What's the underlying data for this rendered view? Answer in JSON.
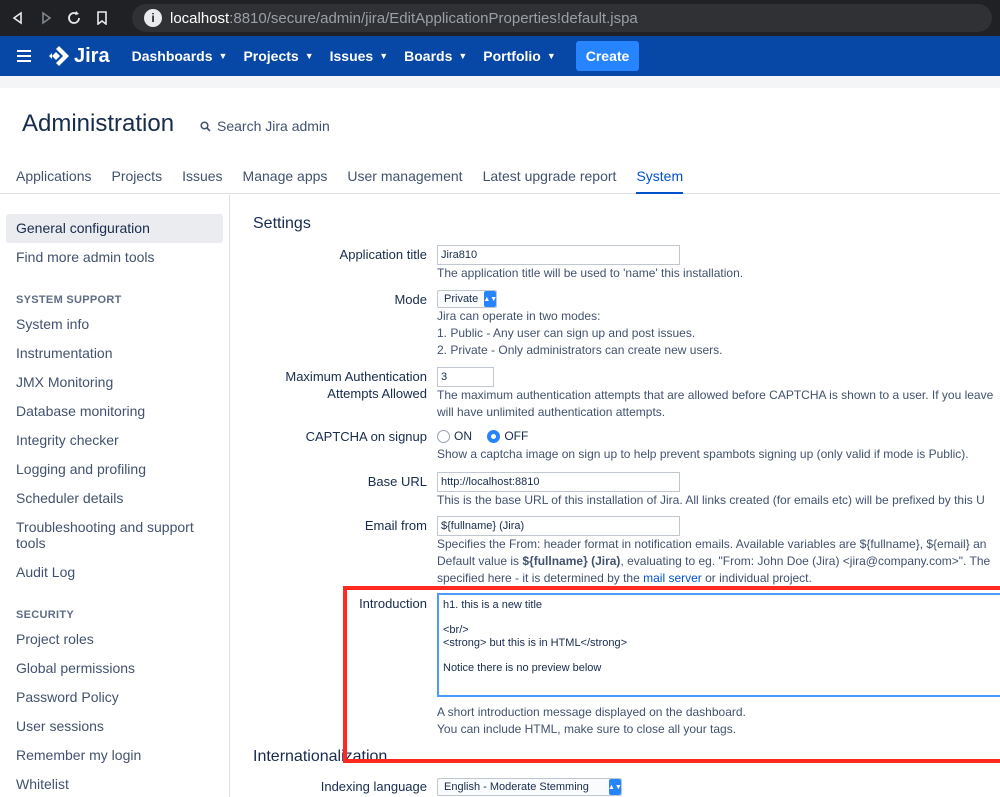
{
  "browser": {
    "url_host": "localhost",
    "url_rest": ":8810/secure/admin/jira/EditApplicationProperties!default.jspa"
  },
  "nav": {
    "logo": "Jira",
    "items": [
      {
        "label": "Dashboards"
      },
      {
        "label": "Projects"
      },
      {
        "label": "Issues"
      },
      {
        "label": "Boards"
      },
      {
        "label": "Portfolio"
      }
    ],
    "create": "Create"
  },
  "admin": {
    "title": "Administration",
    "search": "Search Jira admin",
    "tabs": [
      "Applications",
      "Projects",
      "Issues",
      "Manage apps",
      "User management",
      "Latest upgrade report",
      "System"
    ]
  },
  "sidebar": {
    "top": [
      "General configuration",
      "Find more admin tools"
    ],
    "system_support": {
      "heading": "SYSTEM SUPPORT",
      "items": [
        "System info",
        "Instrumentation",
        "JMX Monitoring",
        "Database monitoring",
        "Integrity checker",
        "Logging and profiling",
        "Scheduler details",
        "Troubleshooting and support tools",
        "Audit Log"
      ]
    },
    "security": {
      "heading": "SECURITY",
      "items": [
        "Project roles",
        "Global permissions",
        "Password Policy",
        "User sessions",
        "Remember my login",
        "Whitelist"
      ]
    }
  },
  "settings": {
    "title": "Settings",
    "app_title": {
      "label": "Application title",
      "value": "Jira810",
      "desc": "The application title will be used to 'name' this installation."
    },
    "mode": {
      "label": "Mode",
      "value": "Private",
      "desc1": "Jira can operate in two modes:",
      "desc2": "1. Public - Any user can sign up and post issues.",
      "desc3": "2. Private - Only administrators can create new users."
    },
    "max_auth": {
      "label1": "Maximum Authentication",
      "label2": "Attempts Allowed",
      "value": "3",
      "desc1": "The maximum authentication attempts that are allowed before CAPTCHA is shown to a user. If you leave",
      "desc2": "will have unlimited authentication attempts."
    },
    "captcha": {
      "label": "CAPTCHA on signup",
      "on": "ON",
      "off": "OFF",
      "desc": "Show a captcha image on sign up to help prevent spambots signing up (only valid if mode is Public)."
    },
    "base_url": {
      "label": "Base URL",
      "value": "http://localhost:8810",
      "desc": "This is the base URL of this installation of Jira. All links created (for emails etc) will be prefixed by this U"
    },
    "email_from": {
      "label": "Email from",
      "value": "${fullname} (Jira)",
      "desc1": "Specifies the From: header format in notification emails. Available variables are ${fullname}, ${email} an",
      "desc2_a": "Default value is ",
      "desc2_b": "${fullname} (Jira)",
      "desc2_c": ", evaluating to eg. \"From: John Doe (Jira) <jira@company.com>\". The",
      "desc3_a": "specified here - it is determined by the ",
      "desc3_link": "mail server",
      "desc3_b": " or individual project."
    },
    "introduction": {
      "label": "Introduction",
      "value": "h1. this is a new title\n\n<br/>\n<strong> but this is in HTML</strong>\n\nNotice there is no preview below",
      "desc1": "A short introduction message displayed on the dashboard.",
      "desc2": "You can include HTML, make sure to close all your tags."
    }
  },
  "i18n": {
    "title": "Internationalization",
    "indexing": {
      "label": "Indexing language",
      "value": "English - Moderate Stemming"
    }
  },
  "colors": {
    "nav": "#0747a6",
    "accent": "#0052cc",
    "highlight": "#ff2a1f"
  }
}
